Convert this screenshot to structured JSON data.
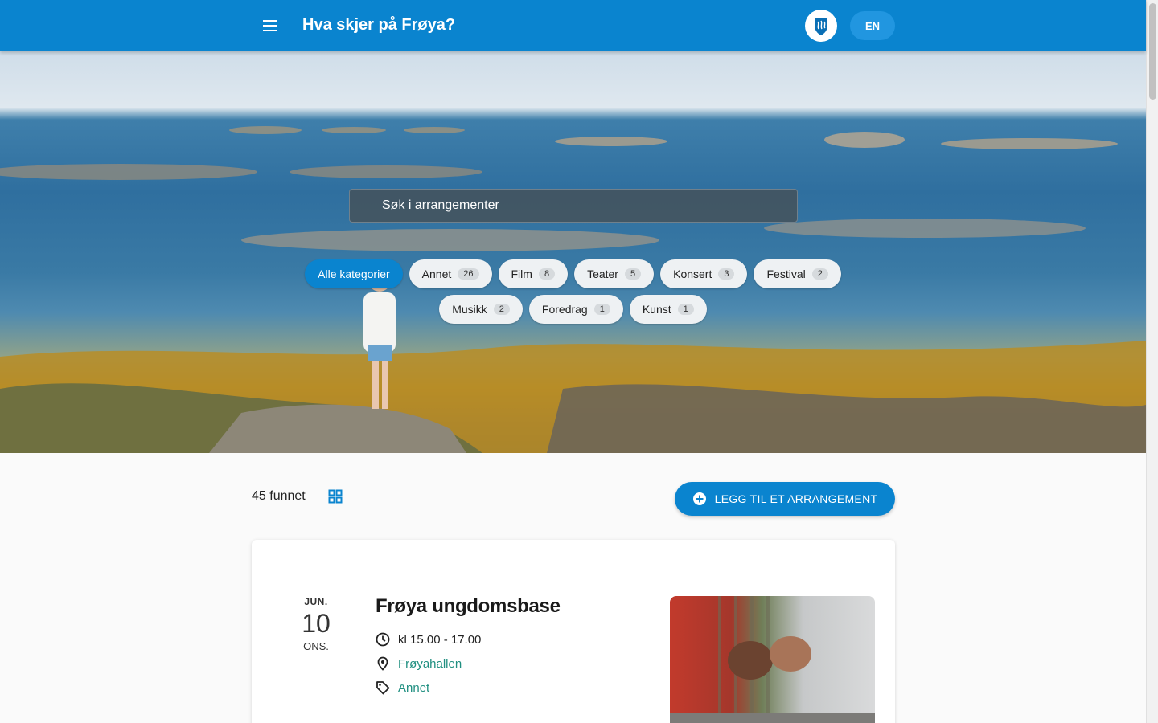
{
  "header": {
    "title": "Hva skjer på Frøya?",
    "lang_label": "EN",
    "menu_icon": "hamburger-menu-icon",
    "crest_icon": "municipal-crest-icon"
  },
  "hero": {
    "search_placeholder": "Søk i arrangementer",
    "chips_row1": [
      {
        "label": "Alle kategorier",
        "count": null,
        "active": true
      },
      {
        "label": "Annet",
        "count": "26"
      },
      {
        "label": "Film",
        "count": "8"
      },
      {
        "label": "Teater",
        "count": "5"
      },
      {
        "label": "Konsert",
        "count": "3"
      },
      {
        "label": "Festival",
        "count": "2"
      }
    ],
    "chips_row2": [
      {
        "label": "Musikk",
        "count": "2"
      },
      {
        "label": "Foredrag",
        "count": "1"
      },
      {
        "label": "Kunst",
        "count": "1"
      }
    ]
  },
  "toolbar": {
    "result_count": "45 funnet",
    "grid_icon": "grid-view-icon",
    "add_button_label": "LEGG TIL ET ARRANGEMENT",
    "add_icon": "plus-circle-icon"
  },
  "event": {
    "month": "JUN.",
    "day": "10",
    "weekday": "ONS.",
    "title": "Frøya ungdomsbase",
    "time": "kl 15.00 - 17.00",
    "location": "Frøyahallen",
    "category": "Annet"
  },
  "colors": {
    "primary": "#0a84cf",
    "link": "#1f8f80"
  }
}
